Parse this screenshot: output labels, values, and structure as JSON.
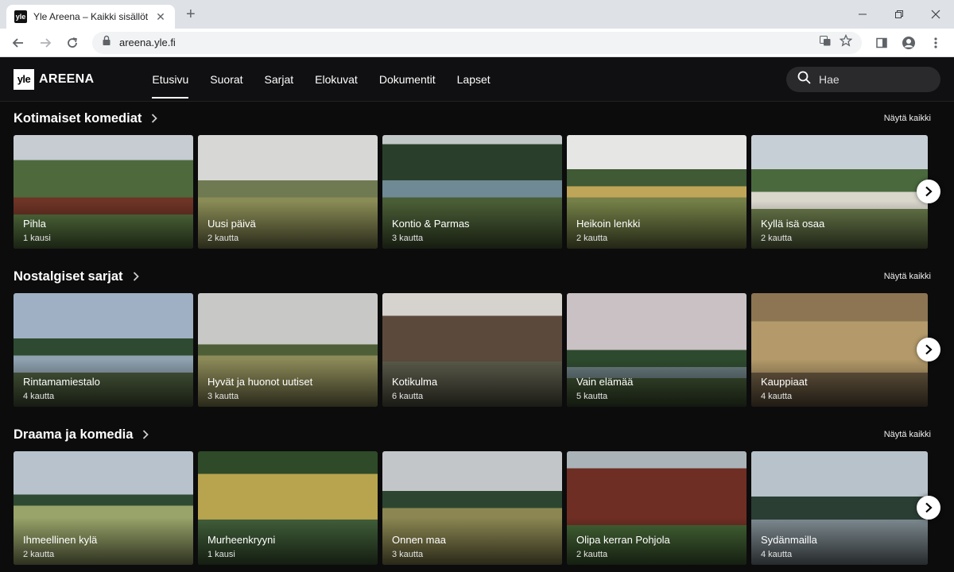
{
  "browser": {
    "tab_title": "Yle Areena – Kaikki sisällöt | Areena",
    "favicon_text": "yle",
    "url": "areena.yle.fi"
  },
  "header": {
    "logo_box": "yle",
    "logo_text": "AREENA",
    "nav": [
      "Etusivu",
      "Suorat",
      "Sarjat",
      "Elokuvat",
      "Dokumentit",
      "Lapset"
    ],
    "active_nav": "Etusivu",
    "search_placeholder": "Hae"
  },
  "rows": [
    {
      "title": "Kotimaiset komediat",
      "show_all": "Näytä kaikki",
      "cards": [
        {
          "title": "Pihla",
          "sub": "1 kausi"
        },
        {
          "title": "Uusi päivä",
          "sub": "2 kautta"
        },
        {
          "title": "Kontio & Parmas",
          "sub": "3 kautta"
        },
        {
          "title": "Heikoin lenkki",
          "sub": "2 kautta"
        },
        {
          "title": "Kyllä isä osaa",
          "sub": "2 kautta"
        }
      ]
    },
    {
      "title": "Nostalgiset sarjat",
      "show_all": "Näytä kaikki",
      "cards": [
        {
          "title": "Rintamamiestalo",
          "sub": "4 kautta"
        },
        {
          "title": "Hyvät ja huonot uutiset",
          "sub": "3 kautta"
        },
        {
          "title": "Kotikulma",
          "sub": "6 kautta"
        },
        {
          "title": "Vain elämää",
          "sub": "5 kautta"
        },
        {
          "title": "Kauppiaat",
          "sub": "4 kautta"
        }
      ]
    },
    {
      "title": "Draama ja komedia",
      "show_all": "Näytä kaikki",
      "cards": [
        {
          "title": "Ihmeellinen kylä",
          "sub": "2 kautta"
        },
        {
          "title": "Murheenkryyni",
          "sub": "1 kausi"
        },
        {
          "title": "Onnen maa",
          "sub": "3 kautta"
        },
        {
          "title": "Olipa kerran Pohjola",
          "sub": "2 kautta"
        },
        {
          "title": "Sydänmailla",
          "sub": "4 kautta"
        }
      ]
    }
  ]
}
